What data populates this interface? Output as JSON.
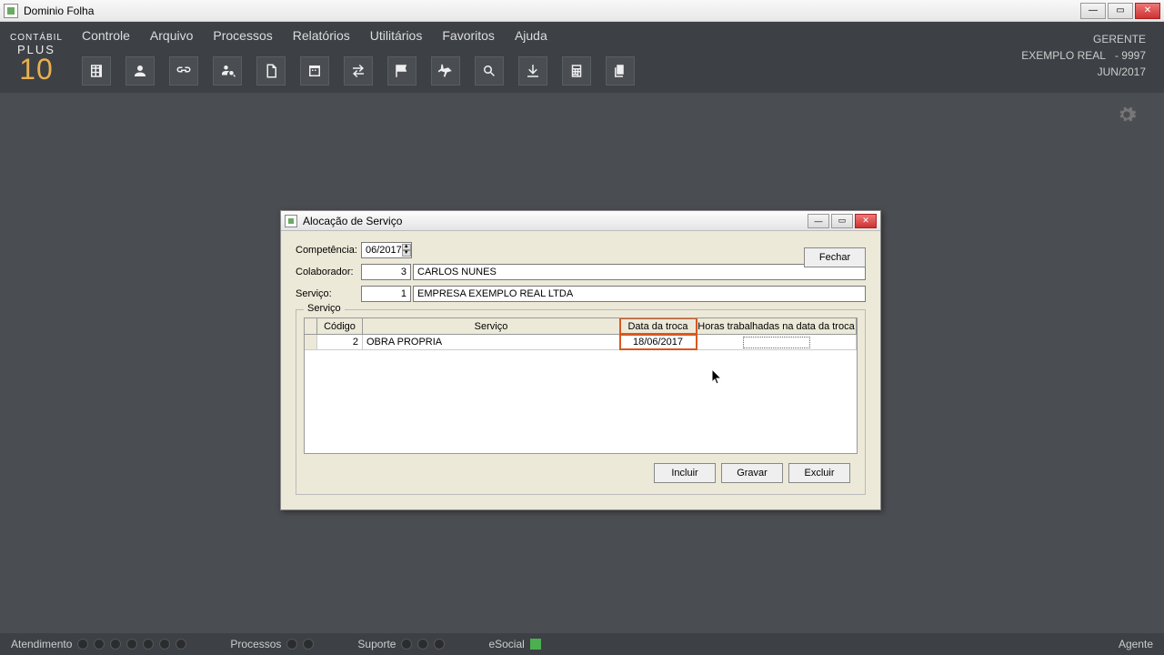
{
  "window": {
    "title": "Dominio Folha"
  },
  "logo": {
    "line1": "CONTÁBIL",
    "line2": "PLUS",
    "line3": "10"
  },
  "menu": [
    "Controle",
    "Arquivo",
    "Processos",
    "Relatórios",
    "Utilitários",
    "Favoritos",
    "Ajuda"
  ],
  "header_info": {
    "role": "GERENTE",
    "company": "EXEMPLO REAL",
    "code": "- 9997",
    "period": "JUN/2017"
  },
  "dialog": {
    "title": "Alocação de Serviço",
    "competencia_label": "Competência:",
    "competencia_value": "06/2017",
    "colaborador_label": "Colaborador:",
    "colaborador_code": "3",
    "colaborador_name": "CARLOS NUNES",
    "servico_label": "Serviço:",
    "servico_code": "1",
    "servico_name": "EMPRESA EXEMPLO REAL LTDA",
    "close_btn": "Fechar",
    "fieldset_legend": "Serviço",
    "grid_headers": {
      "codigo": "Código",
      "servico": "Serviço",
      "data": "Data da troca",
      "horas": "Horas trabalhadas na data da troca"
    },
    "grid_rows": [
      {
        "codigo": "2",
        "servico": "OBRA PROPRIA",
        "data": "18/06/2017",
        "horas": ""
      }
    ],
    "actions": {
      "incluir": "Incluir",
      "gravar": "Gravar",
      "excluir": "Excluir"
    }
  },
  "status": {
    "atendimento": "Atendimento",
    "processos": "Processos",
    "suporte": "Suporte",
    "esocial": "eSocial",
    "agente": "Agente"
  }
}
